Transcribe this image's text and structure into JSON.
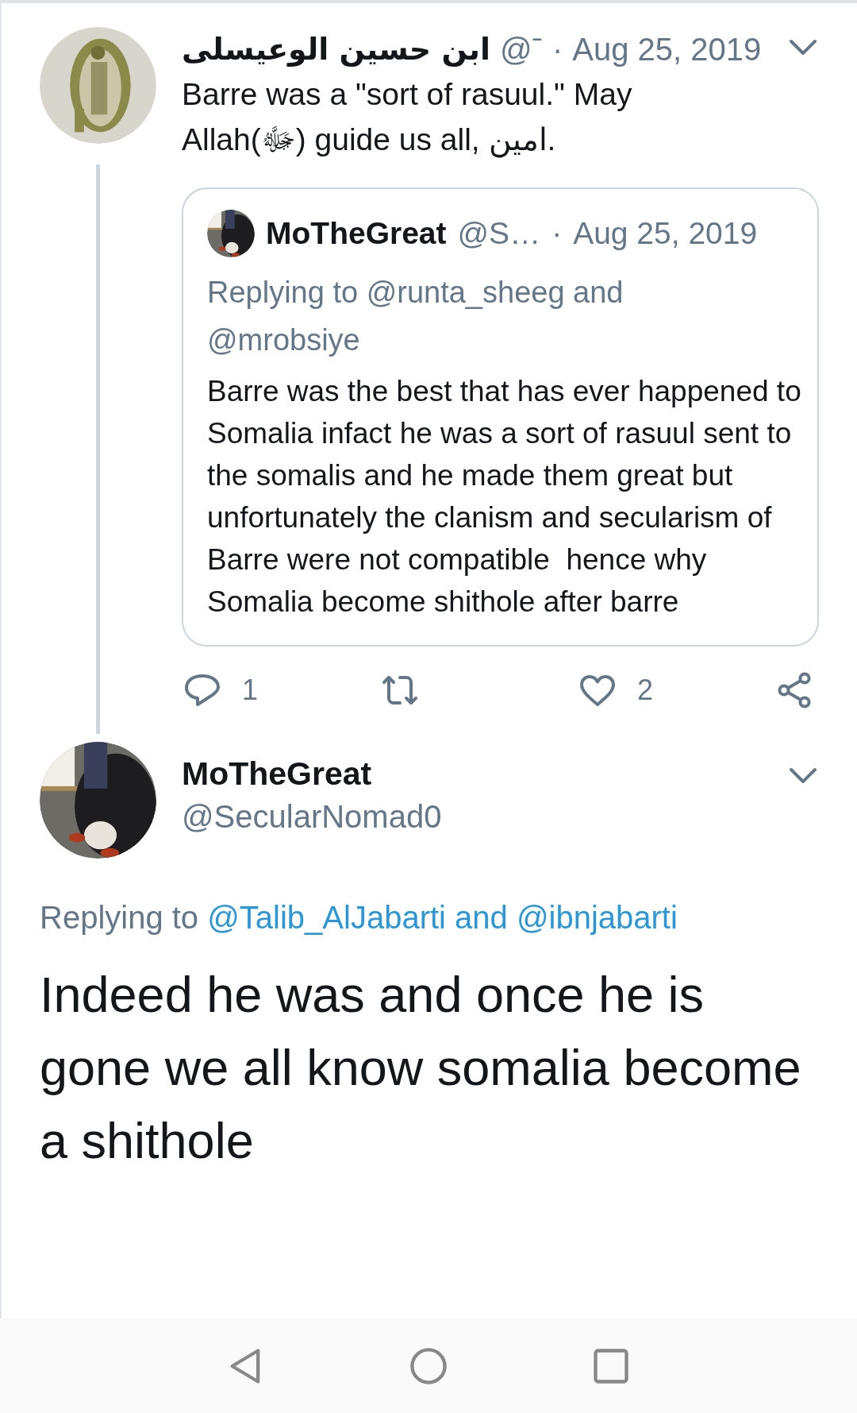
{
  "tweets": [
    {
      "kind": "thread_parent",
      "author": {
        "name": "ابن حسين الوعيسلى",
        "handle": "@ˉ"
      },
      "separator": "·",
      "date": "Aug 25, 2019",
      "text": "Barre was a \"sort of rasuul.\" May Allah(ﷻ) guide us all, امين.",
      "quote": {
        "author": {
          "name": "MoTheGreat",
          "handle": "@S…"
        },
        "separator": "·",
        "date": "Aug 25, 2019",
        "replying_to": "Replying to @runta_sheeg and @mrobsiye",
        "text": "Barre was the best that has ever happened to Somalia infact he was a sort of rasuul sent to the somalis and he made them great but unfortunately the clanism and secularism of Barre were not compatible  hence why Somalia become shithole after barre"
      },
      "actions": [
        {
          "kind": "reply",
          "count": "1"
        },
        {
          "kind": "retweet"
        },
        {
          "kind": "like",
          "count": "2"
        },
        {
          "kind": "share"
        }
      ]
    },
    {
      "kind": "focused",
      "author": {
        "name": "MoTheGreat",
        "handle": "@SecularNomad0"
      },
      "replying_to": {
        "prefix": "Replying to",
        "mentions": "@Talib_AlJabarti and @ibnjabarti"
      },
      "text": "Indeed he was and once he is gone we all know somalia become a shithole"
    }
  ],
  "nav_bar": [
    {
      "kind": "back"
    },
    {
      "kind": "home"
    },
    {
      "kind": "recents"
    }
  ]
}
